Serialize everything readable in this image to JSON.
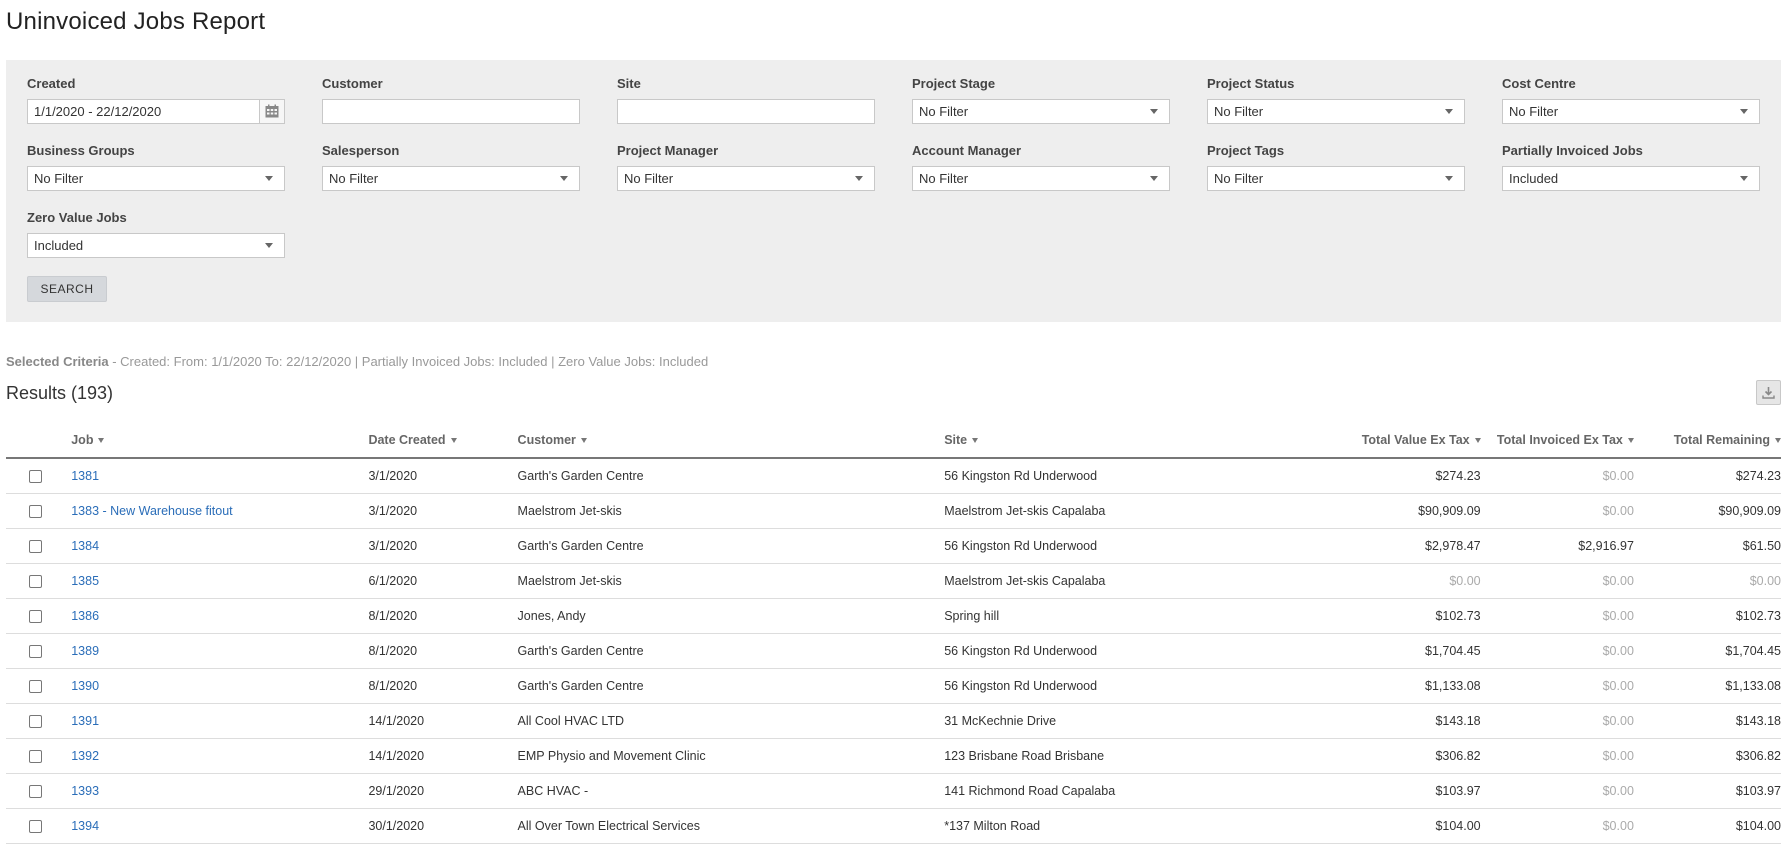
{
  "page": {
    "title": "Uninvoiced Jobs Report"
  },
  "filters": {
    "created": {
      "label": "Created",
      "value": "1/1/2020 - 22/12/2020"
    },
    "customer": {
      "label": "Customer",
      "value": ""
    },
    "site": {
      "label": "Site",
      "value": ""
    },
    "project_stage": {
      "label": "Project Stage",
      "value": "No Filter"
    },
    "project_status": {
      "label": "Project Status",
      "value": "No Filter"
    },
    "cost_centre": {
      "label": "Cost Centre",
      "value": "No Filter"
    },
    "business_groups": {
      "label": "Business Groups",
      "value": "No Filter"
    },
    "salesperson": {
      "label": "Salesperson",
      "value": "No Filter"
    },
    "project_manager": {
      "label": "Project Manager",
      "value": "No Filter"
    },
    "account_manager": {
      "label": "Account Manager",
      "value": "No Filter"
    },
    "project_tags": {
      "label": "Project Tags",
      "value": "No Filter"
    },
    "partially_invoiced": {
      "label": "Partially Invoiced Jobs",
      "value": "Included"
    },
    "zero_value": {
      "label": "Zero Value Jobs",
      "value": "Included"
    },
    "search_label": "SEARCH"
  },
  "criteria": {
    "label": "Selected Criteria",
    "text": " - Created: From: 1/1/2020 To: 22/12/2020 | Partially Invoiced Jobs: Included | Zero Value Jobs: Included"
  },
  "results": {
    "title": "Results (193)",
    "columns": {
      "job": "Job",
      "date_created": "Date Created",
      "customer": "Customer",
      "site": "Site",
      "total_value": "Total Value Ex Tax",
      "total_invoiced": "Total Invoiced Ex Tax",
      "total_remaining": "Total Remaining"
    },
    "rows": [
      {
        "job": "1381",
        "date": "3/1/2020",
        "customer": "Garth's Garden Centre",
        "site": "56 Kingston Rd Underwood",
        "value": "$274.23",
        "invoiced": "$0.00",
        "remaining": "$274.23"
      },
      {
        "job": "1383 - New Warehouse fitout",
        "date": "3/1/2020",
        "customer": "Maelstrom Jet-skis",
        "site": "Maelstrom Jet-skis Capalaba",
        "value": "$90,909.09",
        "invoiced": "$0.00",
        "remaining": "$90,909.09"
      },
      {
        "job": "1384",
        "date": "3/1/2020",
        "customer": "Garth's Garden Centre",
        "site": "56 Kingston Rd Underwood",
        "value": "$2,978.47",
        "invoiced": "$2,916.97",
        "remaining": "$61.50"
      },
      {
        "job": "1385",
        "date": "6/1/2020",
        "customer": "Maelstrom Jet-skis",
        "site": "Maelstrom Jet-skis Capalaba",
        "value": "$0.00",
        "invoiced": "$0.00",
        "remaining": "$0.00"
      },
      {
        "job": "1386",
        "date": "8/1/2020",
        "customer": "Jones, Andy",
        "site": "Spring hill",
        "value": "$102.73",
        "invoiced": "$0.00",
        "remaining": "$102.73"
      },
      {
        "job": "1389",
        "date": "8/1/2020",
        "customer": "Garth's Garden Centre",
        "site": "56 Kingston Rd Underwood",
        "value": "$1,704.45",
        "invoiced": "$0.00",
        "remaining": "$1,704.45"
      },
      {
        "job": "1390",
        "date": "8/1/2020",
        "customer": "Garth's Garden Centre",
        "site": "56 Kingston Rd Underwood",
        "value": "$1,133.08",
        "invoiced": "$0.00",
        "remaining": "$1,133.08"
      },
      {
        "job": "1391",
        "date": "14/1/2020",
        "customer": "All Cool HVAC LTD",
        "site": "31 McKechnie Drive",
        "value": "$143.18",
        "invoiced": "$0.00",
        "remaining": "$143.18"
      },
      {
        "job": "1392",
        "date": "14/1/2020",
        "customer": "EMP Physio and Movement Clinic",
        "site": "123 Brisbane Road Brisbane",
        "value": "$306.82",
        "invoiced": "$0.00",
        "remaining": "$306.82"
      },
      {
        "job": "1393",
        "date": "29/1/2020",
        "customer": "ABC HVAC -",
        "site": "141 Richmond Road Capalaba",
        "value": "$103.97",
        "invoiced": "$0.00",
        "remaining": "$103.97"
      },
      {
        "job": "1394",
        "date": "30/1/2020",
        "customer": "All Over Town Electrical Services",
        "site": "*137 Milton Road",
        "value": "$104.00",
        "invoiced": "$0.00",
        "remaining": "$104.00"
      }
    ]
  },
  "icons": {
    "calendar": "calendar-icon",
    "download": "download-icon",
    "sort": "sort-arrow-icon"
  },
  "colors": {
    "link": "#2a6db8",
    "panel": "#eeeeee",
    "muted": "#aaaaaa"
  }
}
